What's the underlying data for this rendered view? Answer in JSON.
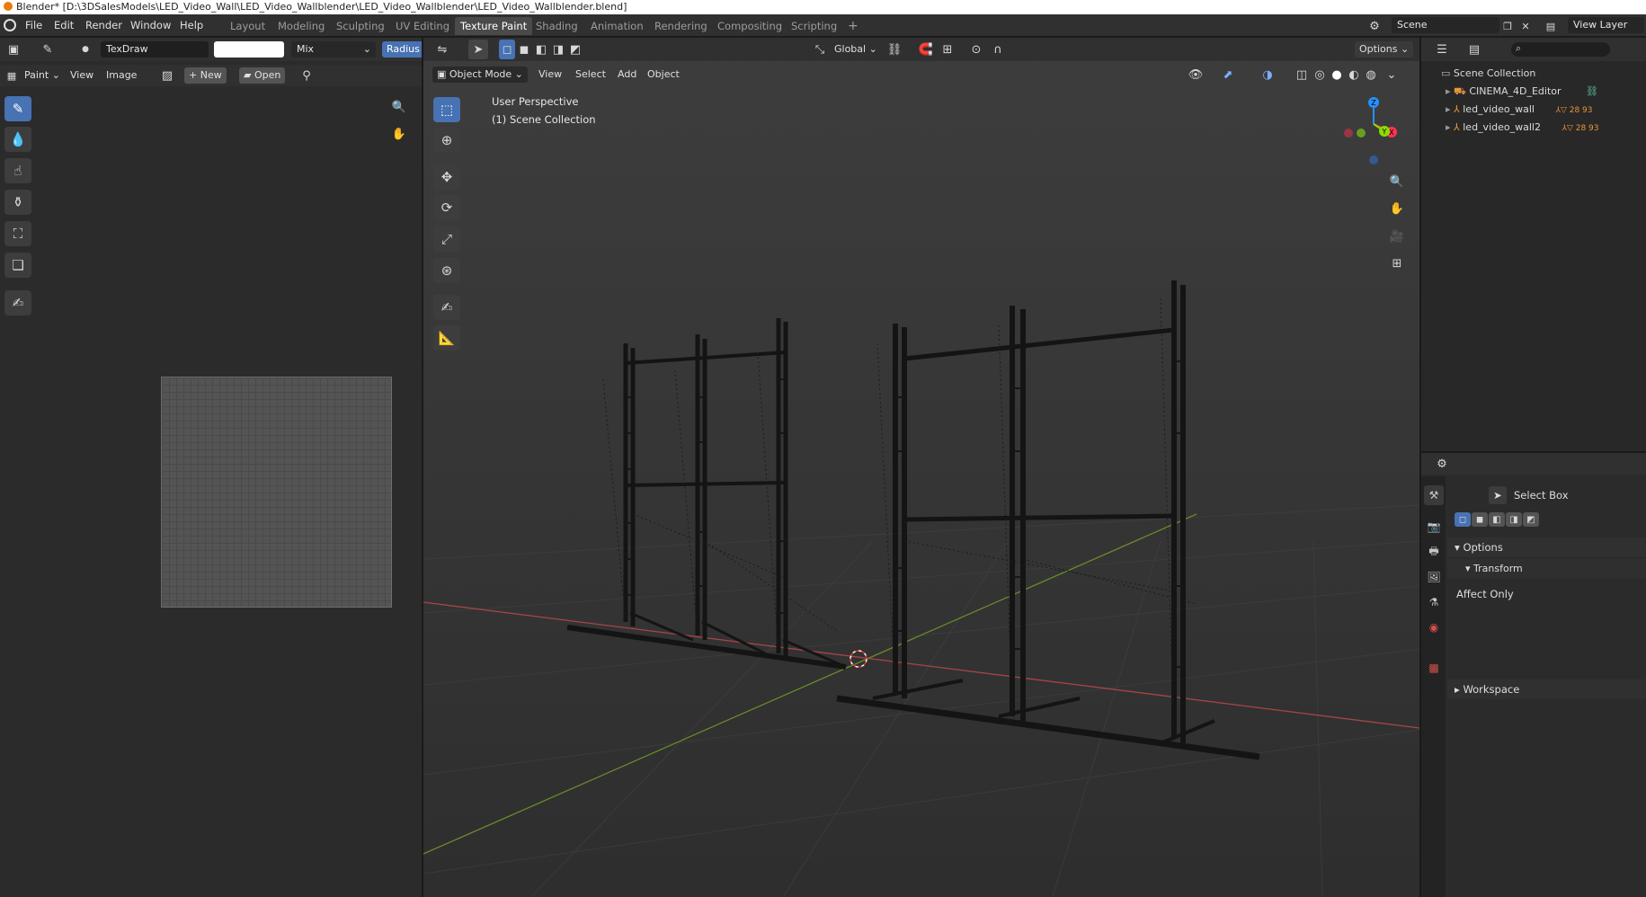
{
  "window": {
    "title": "Blender* [D:\\3DSalesModels\\LED_Video_Wall\\LED_Video_Wallblender\\LED_Video_Wallblender\\LED_Video_Wallblender.blend]"
  },
  "menubar": {
    "items": [
      "File",
      "Edit",
      "Render",
      "Window",
      "Help"
    ]
  },
  "workspaces": {
    "tabs": [
      "Layout",
      "Modeling",
      "Sculpting",
      "UV Editing",
      "Texture Paint",
      "Shading",
      "Animation",
      "Rendering",
      "Compositing",
      "Scripting"
    ],
    "active": "Texture Paint",
    "add_symbol": "+"
  },
  "scene": {
    "label": "Scene"
  },
  "view_layer": {
    "label": "View Layer"
  },
  "image_editor": {
    "brush_name": "TexDraw",
    "blend_mode": "Mix",
    "radius_label": "Radius",
    "mode_label": "Paint",
    "menus": [
      "View",
      "Image"
    ],
    "new_label": "New",
    "open_label": "Open"
  },
  "viewport": {
    "mode_label": "Object Mode",
    "menus": [
      "View",
      "Select",
      "Add",
      "Object"
    ],
    "orientation": "Global",
    "options_label": "Options",
    "overlay_line1": "User Perspective",
    "overlay_line2": "(1) Scene Collection",
    "gizmo_axes": {
      "z": "Z",
      "x": "X",
      "y": "Y"
    },
    "colors": {
      "x_axis": "#ff3352",
      "y_axis": "#8bdc00",
      "z_axis": "#2890ff",
      "active_tool": "#4772b3"
    }
  },
  "outliner": {
    "root": "Scene Collection",
    "items": [
      {
        "name": "CINEMA_4D_Editor",
        "badge": ""
      },
      {
        "name": "led_video_wall",
        "badge": "28  93"
      },
      {
        "name": "led_video_wall2",
        "badge": "28  93"
      }
    ],
    "search_placeholder": ""
  },
  "properties": {
    "tool_name": "Select Box",
    "options_label": "Options",
    "transform_label": "Transform",
    "affect_only_label": "Affect Only",
    "workspace_label": "Workspace"
  }
}
